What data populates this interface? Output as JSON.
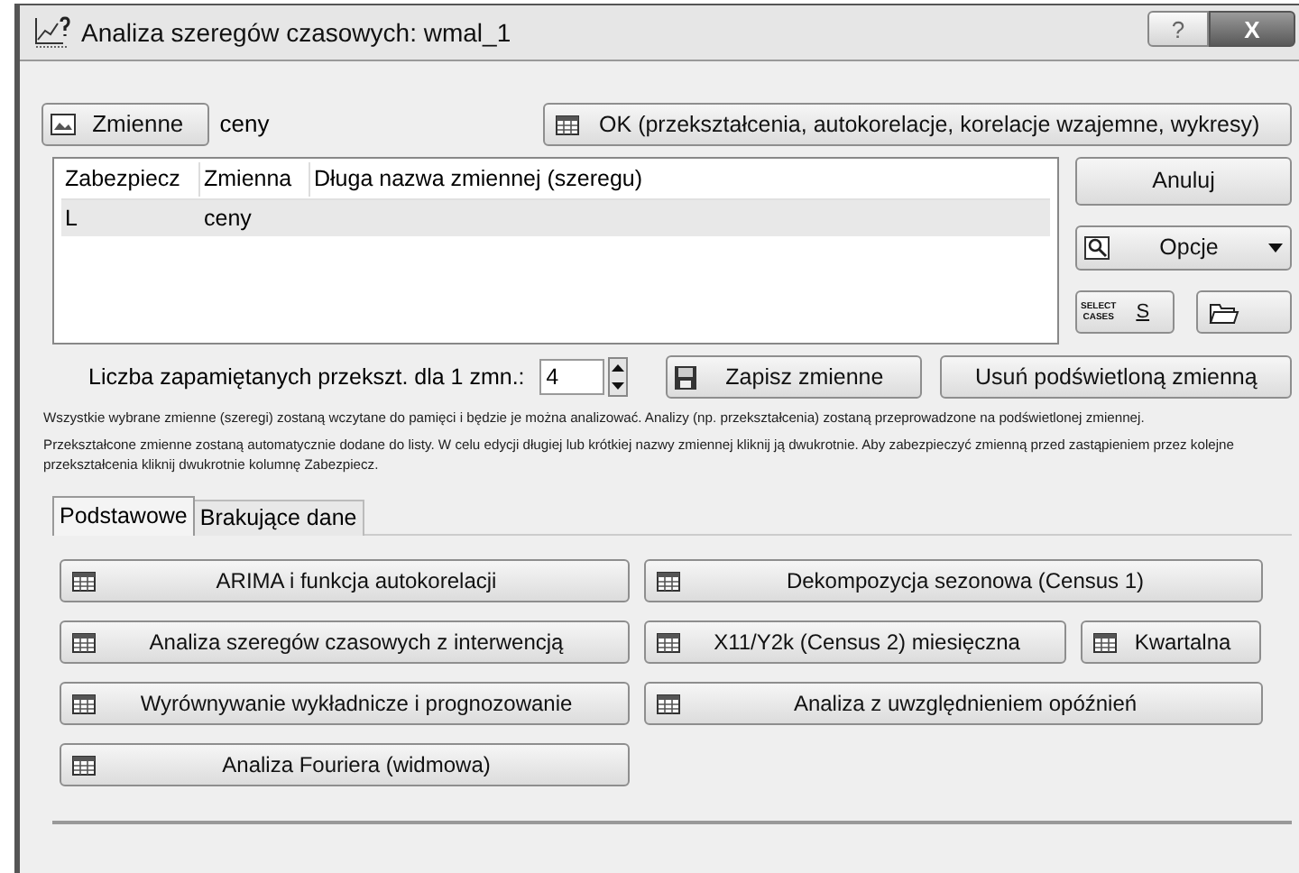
{
  "window": {
    "title": "Analiza szeregów czasowych: wmal_1",
    "help": "?",
    "close": "X"
  },
  "variables_button": "Zmienne",
  "selected_variable": "ceny",
  "ok_button": "OK (przekształcenia, autokorelacje, korelacje wzajemne, wykresy)",
  "table": {
    "columns": [
      "Zabezpiecz",
      "Zmienna",
      "Długa nazwa zmiennej (szeregu)"
    ],
    "rows": [
      {
        "cells": [
          "L",
          "ceny",
          ""
        ],
        "selected": true
      }
    ]
  },
  "side_buttons": {
    "cancel": "Anuluj",
    "options": "Opcje",
    "select_cases": [
      "SELECT",
      "CASES"
    ],
    "select_cases_key": "S"
  },
  "memory": {
    "label": "Liczba zapamiętanych przekszt. dla 1 zmn.:",
    "value": "4",
    "save": "Zapisz zmienne",
    "remove": "Usuń podświetloną zmienną"
  },
  "notes": [
    "Wszystkie wybrane zmienne (szeregi) zostaną wczytane do pamięci i będzie je można analizować. Analizy (np. przekształcenia) zostaną przeprowadzone na podświetlonej zmiennej.",
    "Przekształcone zmienne zostaną automatycznie dodane do listy. W celu edycji długiej lub krótkiej nazwy zmiennej kliknij ją dwukrotnie. Aby zabezpieczyć zmienną przed zastąpieniem przez kolejne przekształcenia kliknij dwukrotnie kolumnę Zabezpiecz."
  ],
  "tabs": [
    {
      "label": "Podstawowe",
      "selected": true
    },
    {
      "label": "Brakujące dane",
      "selected": false
    }
  ],
  "analysis_buttons": [
    [
      "ARIMA i funkcja autokorelacji",
      "Dekompozycja sezonowa (Census 1)"
    ],
    [
      "Analiza szeregów czasowych z interwencją",
      "X11/Y2k (Census 2) miesięczna",
      "Kwartalna"
    ],
    [
      "Wyrównywanie wykładnicze i prognozowanie",
      "Analiza z uwzględnieniem opóźnień"
    ],
    [
      "Analiza Fouriera (widmowa)"
    ]
  ]
}
